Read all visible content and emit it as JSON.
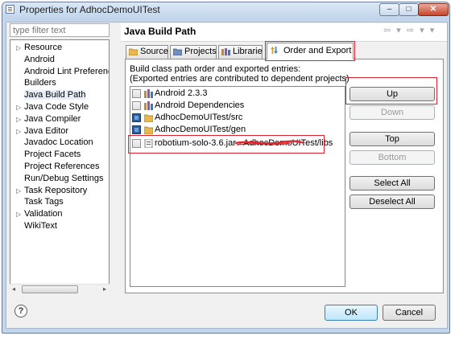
{
  "window": {
    "title": "Properties for AdhocDemoUITest",
    "minimize_glyph": "–",
    "maximize_glyph": "□",
    "close_glyph": "✕"
  },
  "sidebar": {
    "filter_placeholder": "type filter text",
    "items": [
      {
        "label": "Resource",
        "expandable": true
      },
      {
        "label": "Android",
        "expandable": false
      },
      {
        "label": "Android Lint Preferences",
        "expandable": false
      },
      {
        "label": "Builders",
        "expandable": false
      },
      {
        "label": "Java Build Path",
        "expandable": false,
        "selected": true
      },
      {
        "label": "Java Code Style",
        "expandable": true
      },
      {
        "label": "Java Compiler",
        "expandable": true
      },
      {
        "label": "Java Editor",
        "expandable": true
      },
      {
        "label": "Javadoc Location",
        "expandable": false
      },
      {
        "label": "Project Facets",
        "expandable": false
      },
      {
        "label": "Project References",
        "expandable": false
      },
      {
        "label": "Run/Debug Settings",
        "expandable": false
      },
      {
        "label": "Task Repository",
        "expandable": true
      },
      {
        "label": "Task Tags",
        "expandable": false
      },
      {
        "label": "Validation",
        "expandable": true
      },
      {
        "label": "WikiText",
        "expandable": false
      }
    ]
  },
  "main": {
    "title": "Java Build Path",
    "nav_glyphs": "⇦ ▾ ⇨ ▾ ▾",
    "tabs": [
      {
        "label": "Source",
        "icon": "source-folder-icon"
      },
      {
        "label": "Projects",
        "icon": "projects-icon"
      },
      {
        "label": "Libraries",
        "icon": "libraries-icon"
      },
      {
        "label": "Order and Export",
        "icon": "order-export-icon",
        "active": true
      }
    ],
    "description_line1": "Build class path order and exported entries:",
    "description_line2": "(Exported entries are contributed to dependent projects)",
    "entries": [
      {
        "label": "Android 2.3.3",
        "checked": false,
        "icon": "library-icon"
      },
      {
        "label": "Android Dependencies",
        "checked": false,
        "icon": "library-icon"
      },
      {
        "label": "AdhocDemoUITest/src",
        "checked": true,
        "icon": "source-folder-icon"
      },
      {
        "label": "AdhocDemoUITest/gen",
        "checked": true,
        "icon": "source-folder-icon"
      },
      {
        "label": "robotium-solo-3.6.jar - AdhocDemoUITest/libs",
        "checked": false,
        "icon": "jar-icon",
        "selected": true
      }
    ],
    "buttons": {
      "up": "Up",
      "down": "Down",
      "top": "Top",
      "bottom": "Bottom",
      "select_all": "Select All",
      "deselect_all": "Deselect All"
    }
  },
  "footer": {
    "help_glyph": "?",
    "ok": "OK",
    "cancel": "Cancel"
  },
  "colors": {
    "highlight_box": "#d9222e",
    "window_frame": "#c4d6ec",
    "checked_box": "#2a5d9a",
    "redaction_stroke": "#e0252d"
  }
}
